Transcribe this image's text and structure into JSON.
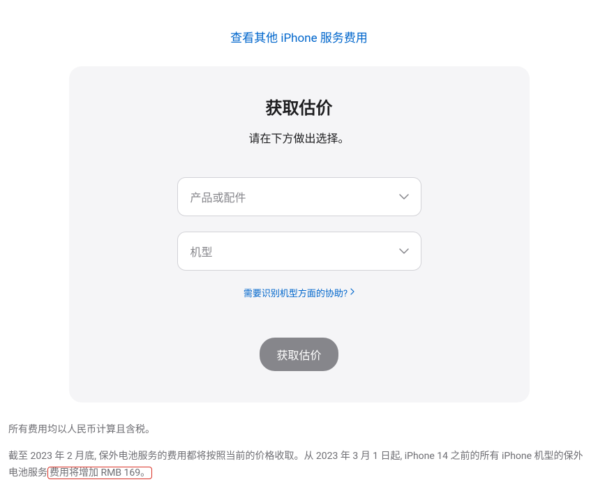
{
  "topLink": "查看其他 iPhone 服务费用",
  "card": {
    "title": "获取估价",
    "subtitle": "请在下方做出选择。",
    "select1": {
      "placeholder": "产品或配件"
    },
    "select2": {
      "placeholder": "机型"
    },
    "helpLink": "需要识别机型方面的协助?",
    "submitButton": "获取估价"
  },
  "footer": {
    "line1": "所有费用均以人民币计算且含税。",
    "line2Part1": "截至 2023 年 2 月底, 保外电池服务的费用都将按照当前的价格收取。从 2023 年 3 月 1 日起, iPhone 14 之前的所有 iPhone 机型的保外电池服务",
    "line2Highlight": "费用将增加 RMB 169。"
  }
}
